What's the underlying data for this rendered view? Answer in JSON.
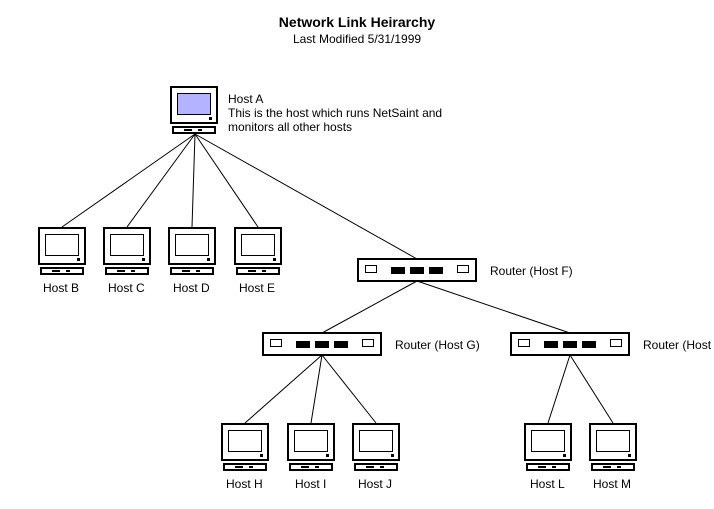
{
  "title": "Network Link Heirarchy",
  "subtitle": "Last Modified 5/31/1999",
  "hostA": {
    "label": "Host A",
    "note": "This is the host which runs NetSaint and\nmonitors all other hosts"
  },
  "level2": {
    "hostB": "Host B",
    "hostC": "Host C",
    "hostD": "Host D",
    "hostE": "Host E",
    "routerF": "Router (Host F)"
  },
  "level3": {
    "routerG": "Router (Host G)",
    "routerK": "Router (Host K)"
  },
  "level4": {
    "hostH": "Host H",
    "hostI": "Host I",
    "hostJ": "Host J",
    "hostL": "Host L",
    "hostM": "Host M"
  }
}
